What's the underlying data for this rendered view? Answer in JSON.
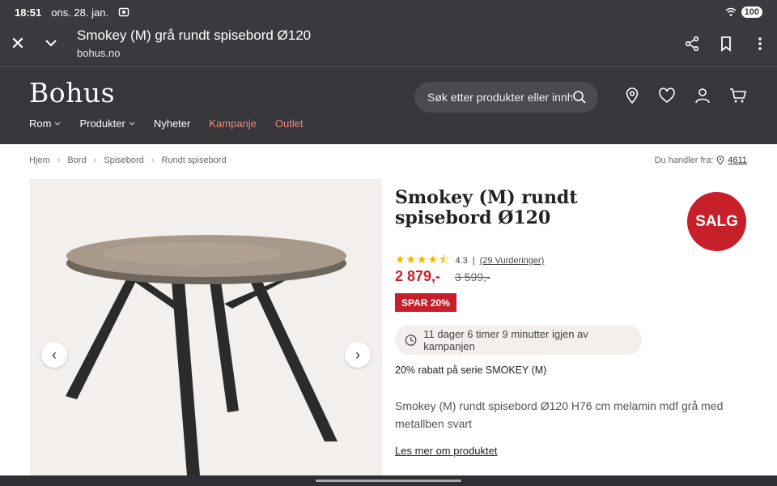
{
  "status": {
    "time": "18:51",
    "date": "ons. 28. jan.",
    "battery": "100"
  },
  "browser": {
    "title": "Smokey (M) grå rundt spisebord Ø120",
    "url": "bohus.no"
  },
  "site": {
    "logo": "Bohus",
    "search_placeholder": "Søk etter produkter eller innhold",
    "nav": [
      {
        "label": "Rom",
        "dropdown": true
      },
      {
        "label": "Produkter",
        "dropdown": true
      },
      {
        "label": "Nyheter",
        "dropdown": false
      },
      {
        "label": "Kampanje",
        "dropdown": false,
        "highlight": true
      },
      {
        "label": "Outlet",
        "dropdown": false,
        "highlight": true
      }
    ]
  },
  "breadcrumb": [
    "Hjem",
    "Bord",
    "Spisebord",
    "Rundt spisebord"
  ],
  "location": {
    "label": "Du handler fra:",
    "zip": "4611"
  },
  "product": {
    "title": "Smokey (M) rundt spisebord Ø120",
    "badge": "SALG",
    "rating": "4.3",
    "reviews": "(29 Vurderinger)",
    "price": "2 879,-",
    "old_price": "3 599,-",
    "save_label": "SPAR 20%",
    "timer_text": "11 dager 6 timer 9 minutter igjen av kampanjen",
    "discount_text": "20% rabatt på serie SMOKEY (M)",
    "description": "Smokey (M) rundt spisebord Ø120 H76 cm melamin mdf grå med metallben svart",
    "read_more": "Les mer om produktet"
  },
  "colors": {
    "accent": "#c8202a",
    "header": "#36363b",
    "sale_nav": "#f08a7f",
    "star": "#f2b600"
  }
}
